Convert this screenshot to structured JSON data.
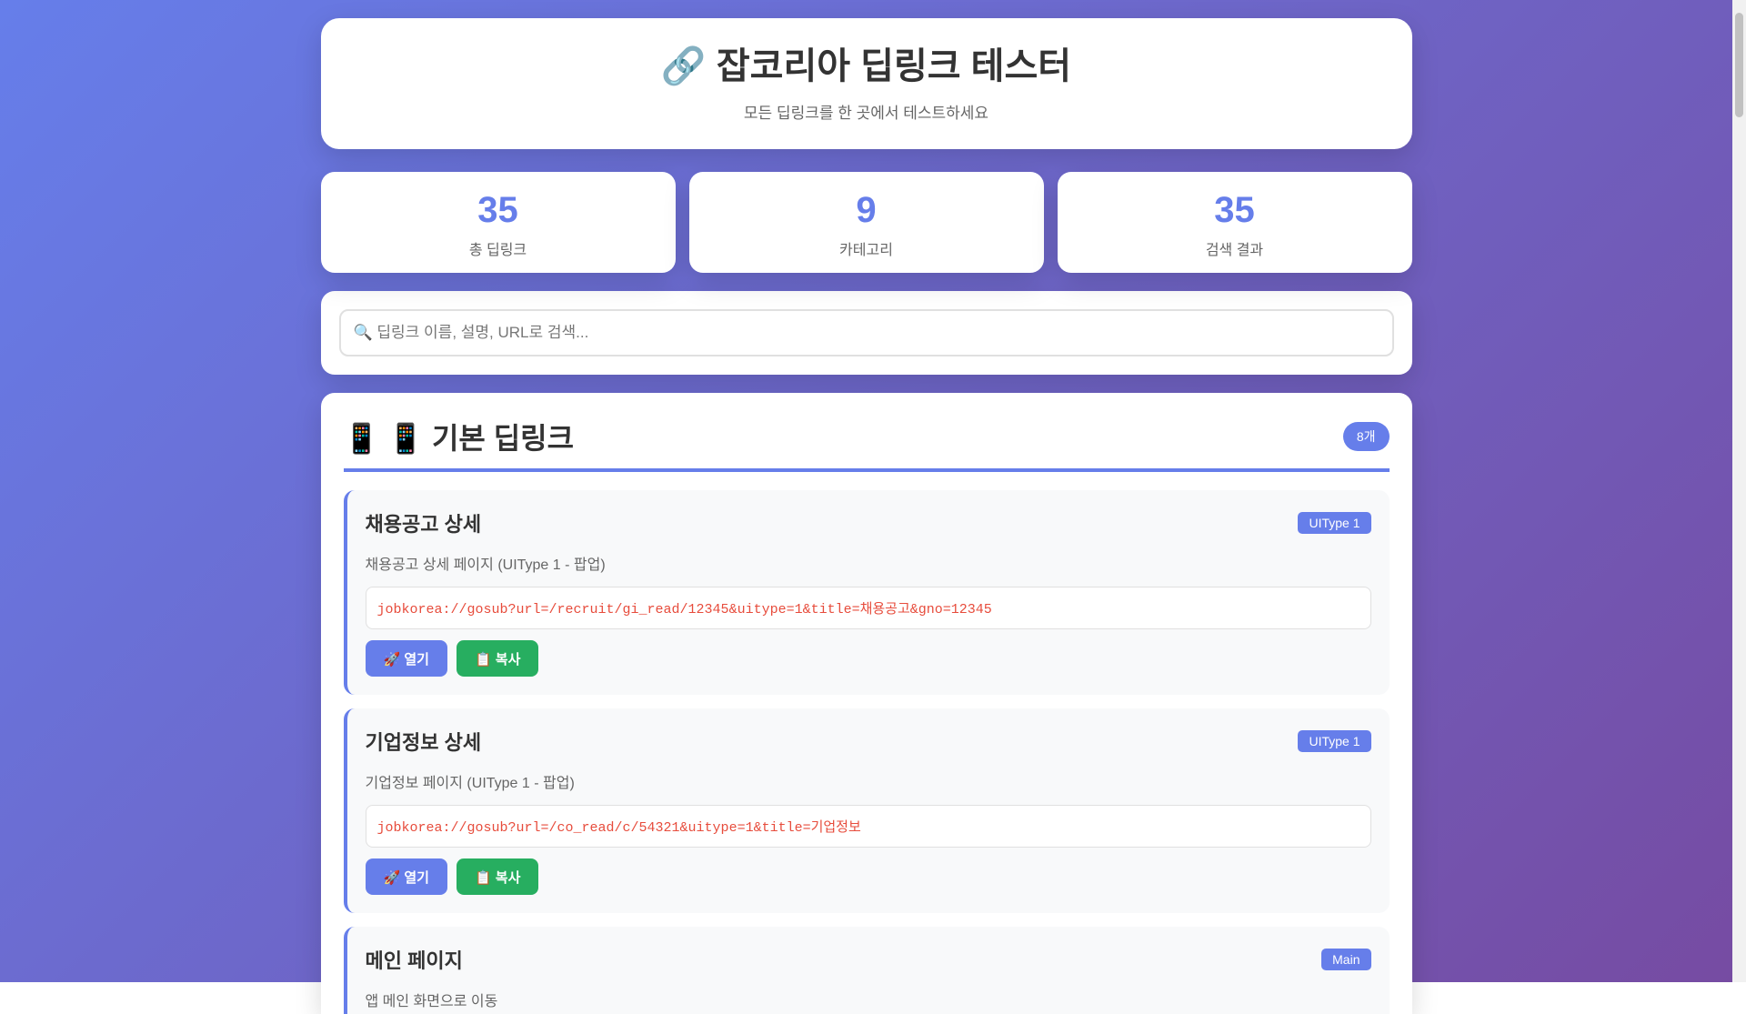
{
  "header": {
    "icon": "🔗",
    "title": "잡코리아 딥링크 테스터",
    "subtitle": "모든 딥링크를 한 곳에서 테스트하세요"
  },
  "stats": [
    {
      "value": "35",
      "label": "총 딥링크"
    },
    {
      "value": "9",
      "label": "카테고리"
    },
    {
      "value": "35",
      "label": "검색 결과"
    }
  ],
  "search": {
    "placeholder": "🔍 딥링크 이름, 설명, URL로 검색...",
    "value": ""
  },
  "section": {
    "title": "📱 📱 기본 딥링크",
    "count": "8개",
    "items": [
      {
        "title": "채용공고 상세",
        "type": "UIType 1",
        "desc": "채용공고 상세 페이지 (UIType 1 - 팝업)",
        "url": "jobkorea://gosub?url=/recruit/gi_read/12345&uitype=1&title=채용공고&gno=12345"
      },
      {
        "title": "기업정보 상세",
        "type": "UIType 1",
        "desc": "기업정보 페이지 (UIType 1 - 팝업)",
        "url": "jobkorea://gosub?url=/co_read/c/54321&uitype=1&title=기업정보"
      },
      {
        "title": "메인 페이지",
        "type": "Main",
        "desc": "앱 메인 화면으로 이동"
      }
    ]
  },
  "buttons": {
    "open": "🚀 열기",
    "copy": "📋 복사"
  }
}
